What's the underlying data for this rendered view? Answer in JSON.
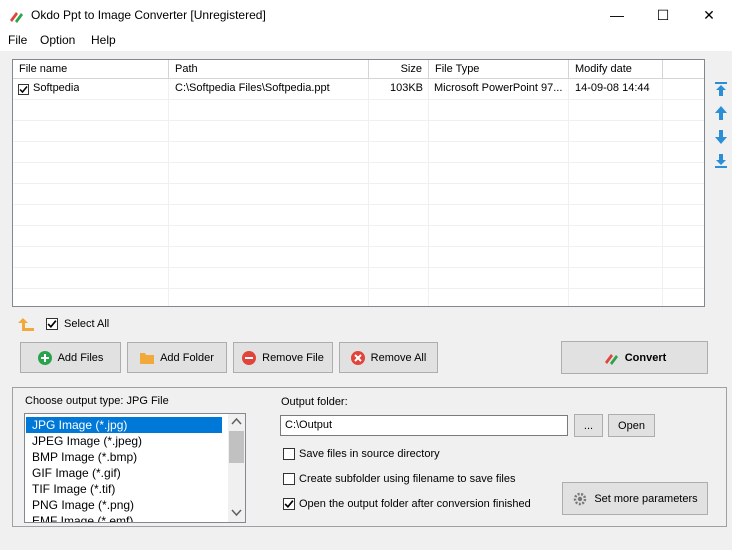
{
  "window": {
    "title": "Okdo Ppt to Image Converter [Unregistered]",
    "minimize": "—",
    "maximize": "☐",
    "close": "✕"
  },
  "menu": {
    "file": "File",
    "option": "Option",
    "help": "Help"
  },
  "columns": [
    "File name",
    "Path",
    "Size",
    "File Type",
    "Modify date"
  ],
  "rows": [
    {
      "name": "Softpedia",
      "path": "C:\\Softpedia Files\\Softpedia.ppt",
      "size": "103KB",
      "type": "Microsoft PowerPoint 97...",
      "date": "14-09-08 14:44",
      "checked": true
    }
  ],
  "select_all": {
    "label": "Select All",
    "checked": true
  },
  "buttons": {
    "add_files": "Add Files",
    "add_folder": "Add Folder",
    "remove_file": "Remove File",
    "remove_all": "Remove All",
    "convert": "Convert",
    "browse": "...",
    "open": "Open",
    "set_more": "Set more parameters"
  },
  "output_type": {
    "label": "Choose output type:  JPG File",
    "options": [
      "JPG Image (*.jpg)",
      "JPEG Image (*.jpeg)",
      "BMP Image (*.bmp)",
      "GIF Image (*.gif)",
      "TIF Image (*.tif)",
      "PNG Image (*.png)",
      "EMF Image (*.emf)"
    ],
    "selected_index": 0
  },
  "output_folder": {
    "label": "Output folder:",
    "value": "C:\\Output"
  },
  "options": {
    "save_in_source": {
      "label": "Save files in source directory",
      "checked": false
    },
    "create_subfolder": {
      "label": "Create subfolder using filename to save files",
      "checked": false
    },
    "open_after": {
      "label": "Open the output folder after conversion finished",
      "checked": true
    }
  },
  "colors": {
    "accent": "#0078d7",
    "arrow_blue": "#2b8fd8",
    "add_green": "#2aa44a",
    "remove_red": "#e0443a",
    "folder_orange": "#f2a93b"
  }
}
